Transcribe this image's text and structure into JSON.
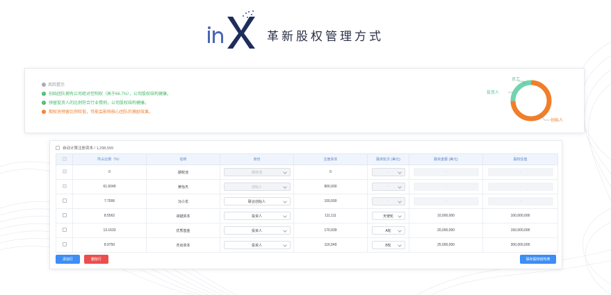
{
  "header": {
    "title": "革新股权管理方式",
    "logo_icon": "inx-logo"
  },
  "risk": {
    "title": "风险提示",
    "items": [
      {
        "type": "ok",
        "text": "创始团队拥有公司绝对控制权（高于66.7%），公司股权结构健康。"
      },
      {
        "type": "ok",
        "text": "预留投资人的比例符合行业惯例，公司股权结构健康。"
      },
      {
        "type": "warn",
        "text": "期权池预留比例较低，可能会影响核心团队的激励效果。"
      }
    ]
  },
  "donut": {
    "labels": {
      "employee": "员工",
      "investor": "投资人",
      "founder": "创始人"
    },
    "fractions": {
      "founder": 0.747,
      "investor": 0.253,
      "employee": 0.0
    },
    "colors": {
      "founder": "#f07e2a",
      "investor": "#6fd4b0",
      "employee": "#6fd4b0"
    }
  },
  "table": {
    "calc_label": "自动计算注册资本 / 1,298,599",
    "headers": [
      "所占比例（%）",
      "名称",
      "身份",
      "注册资本",
      "融资轮次 (美元)",
      "融资金额 (美元)",
      "股权估值"
    ],
    "rows": [
      {
        "ratio": "0",
        "name": "期权池",
        "role": "期权池",
        "role_disabled": true,
        "capital": "0",
        "round": "-",
        "round_disabled": true,
        "amount": "-",
        "amount_disabled": true,
        "valuation": "-",
        "valuation_disabled": true,
        "check_disabled": true
      },
      {
        "ratio": "61.6049",
        "name": "黄怡杰",
        "role": "创始人",
        "role_disabled": true,
        "capital": "800,000",
        "round": "-",
        "round_disabled": true,
        "amount": "-",
        "amount_disabled": true,
        "valuation": "-",
        "valuation_disabled": true,
        "check_disabled": true
      },
      {
        "ratio": "7.7006",
        "name": "冯小龙",
        "role": "联合创始人",
        "role_disabled": false,
        "capital": "100,000",
        "round": "-",
        "round_disabled": true,
        "amount": "-",
        "amount_disabled": true,
        "valuation": "-",
        "valuation_disabled": true,
        "check_disabled": false
      },
      {
        "ratio": "8.5562",
        "name": "卓越资本",
        "role": "投资人",
        "role_disabled": false,
        "capital": "111,111",
        "round": "天使轮",
        "round_disabled": false,
        "amount": "10,000,000",
        "amount_disabled": false,
        "valuation": "100,000,000",
        "valuation_disabled": false,
        "check_disabled": false
      },
      {
        "ratio": "13.1633",
        "name": "优秀基金",
        "role": "投资人",
        "role_disabled": false,
        "capital": "170,939",
        "round": "A轮",
        "round_disabled": false,
        "amount": "20,000,000",
        "amount_disabled": false,
        "valuation": "150,000,000",
        "valuation_disabled": false,
        "check_disabled": false
      },
      {
        "ratio": "8.9750",
        "name": "杰出资本",
        "role": "投资人",
        "role_disabled": false,
        "capital": "116,549",
        "round": "B轮",
        "round_disabled": false,
        "amount": "25,000,000",
        "amount_disabled": false,
        "valuation": "300,000,000",
        "valuation_disabled": false,
        "check_disabled": false
      }
    ]
  },
  "buttons": {
    "add": "添加行",
    "delete": "删除行",
    "save": "保存股权结构表"
  }
}
